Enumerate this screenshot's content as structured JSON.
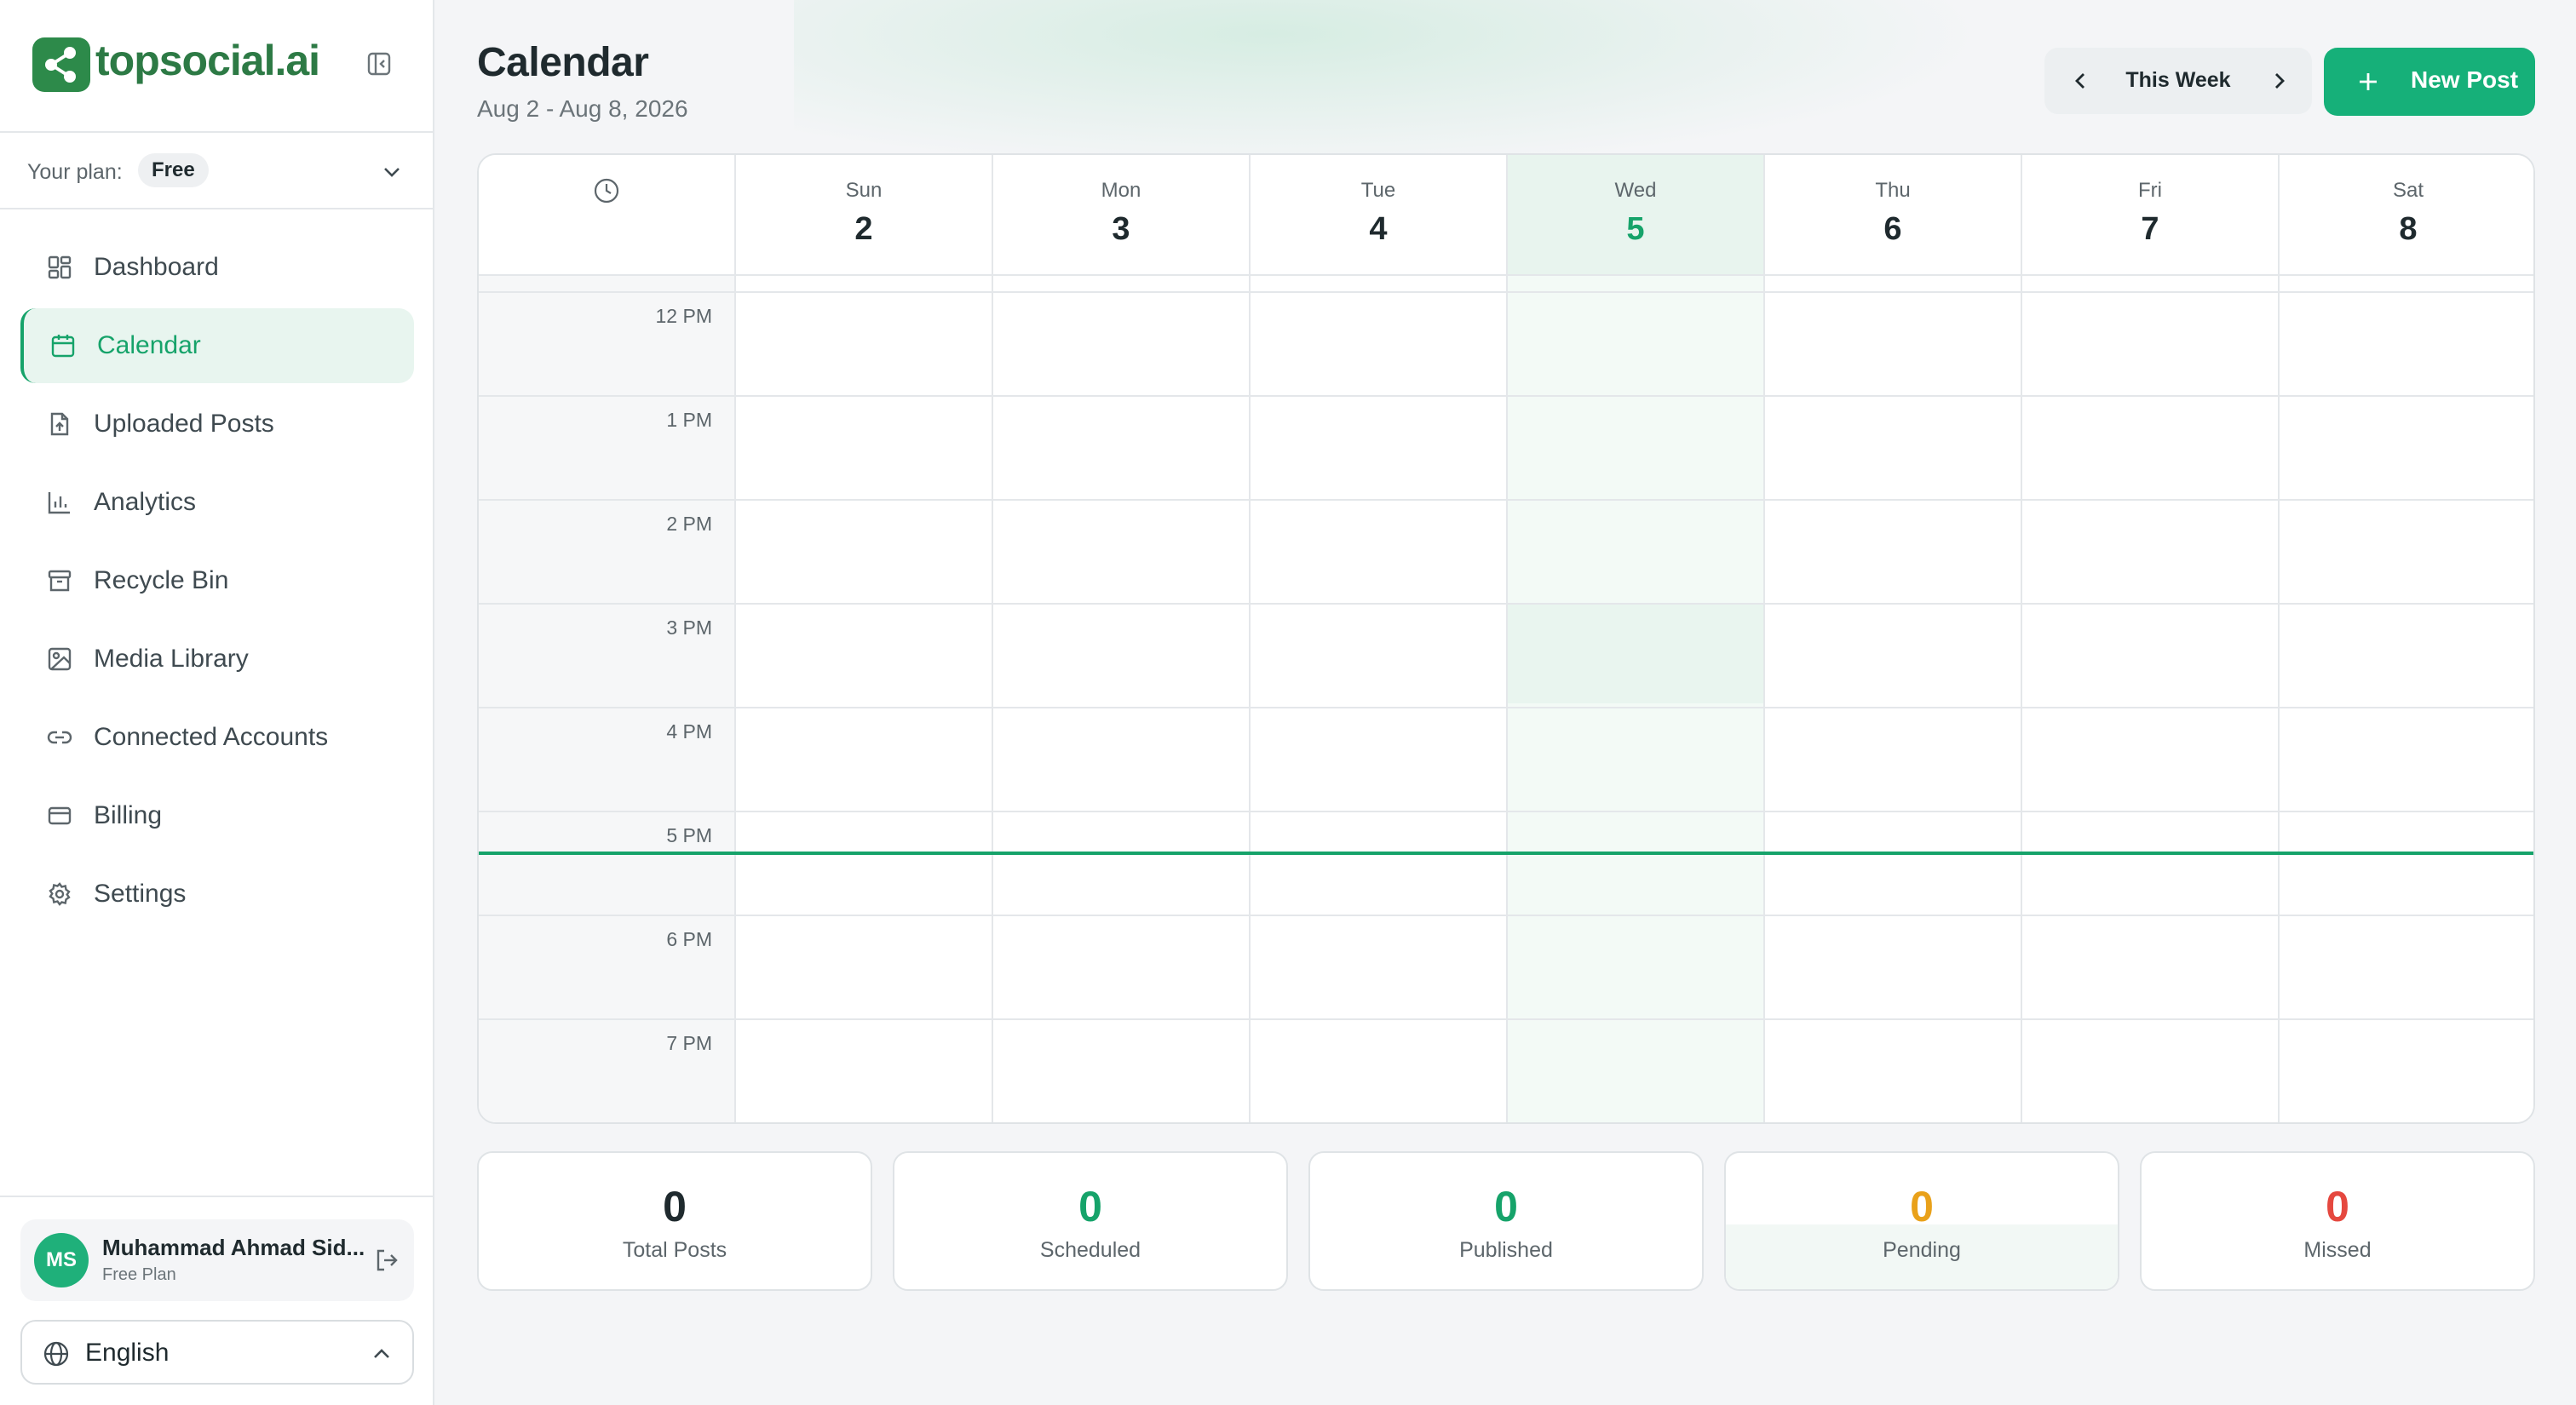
{
  "brand": {
    "name": "topsocial.ai",
    "color": "#2d7a45"
  },
  "plan": {
    "label": "Your plan:",
    "value": "Free"
  },
  "nav": [
    {
      "label": "Dashboard",
      "icon": "dashboard-icon"
    },
    {
      "label": "Calendar",
      "icon": "calendar-icon",
      "active": true
    },
    {
      "label": "Uploaded Posts",
      "icon": "file-upload-icon"
    },
    {
      "label": "Analytics",
      "icon": "bar-chart-icon"
    },
    {
      "label": "Recycle Bin",
      "icon": "archive-icon"
    },
    {
      "label": "Media Library",
      "icon": "image-icon"
    },
    {
      "label": "Connected Accounts",
      "icon": "link-icon"
    },
    {
      "label": "Billing",
      "icon": "credit-card-icon"
    },
    {
      "label": "Settings",
      "icon": "gear-icon"
    }
  ],
  "user": {
    "initials": "MS",
    "name": "Muhammad Ahmad Sid...",
    "plan": "Free Plan"
  },
  "language": "English",
  "header": {
    "title": "Calendar",
    "range": "Aug 2 - Aug 8, 2026",
    "week_label": "This Week",
    "new_post_label": "New Post"
  },
  "days": [
    {
      "name": "Sun",
      "num": "2"
    },
    {
      "name": "Mon",
      "num": "3"
    },
    {
      "name": "Tue",
      "num": "4"
    },
    {
      "name": "Wed",
      "num": "5",
      "today": true
    },
    {
      "name": "Thu",
      "num": "6"
    },
    {
      "name": "Fri",
      "num": "7"
    },
    {
      "name": "Sat",
      "num": "8"
    }
  ],
  "times": [
    "12 PM",
    "1 PM",
    "2 PM",
    "3 PM",
    "4 PM",
    "5 PM",
    "6 PM",
    "7 PM"
  ],
  "stats": [
    {
      "value": "0",
      "label": "Total Posts",
      "color": "#1f2a2e"
    },
    {
      "value": "0",
      "label": "Scheduled",
      "color": "#16a36a"
    },
    {
      "value": "0",
      "label": "Published",
      "color": "#16a36a"
    },
    {
      "value": "0",
      "label": "Pending",
      "color": "#e9a11a"
    },
    {
      "value": "0",
      "label": "Missed",
      "color": "#e5483f"
    }
  ],
  "colors": {
    "accent": "#16a36a",
    "button": "#16b079"
  }
}
